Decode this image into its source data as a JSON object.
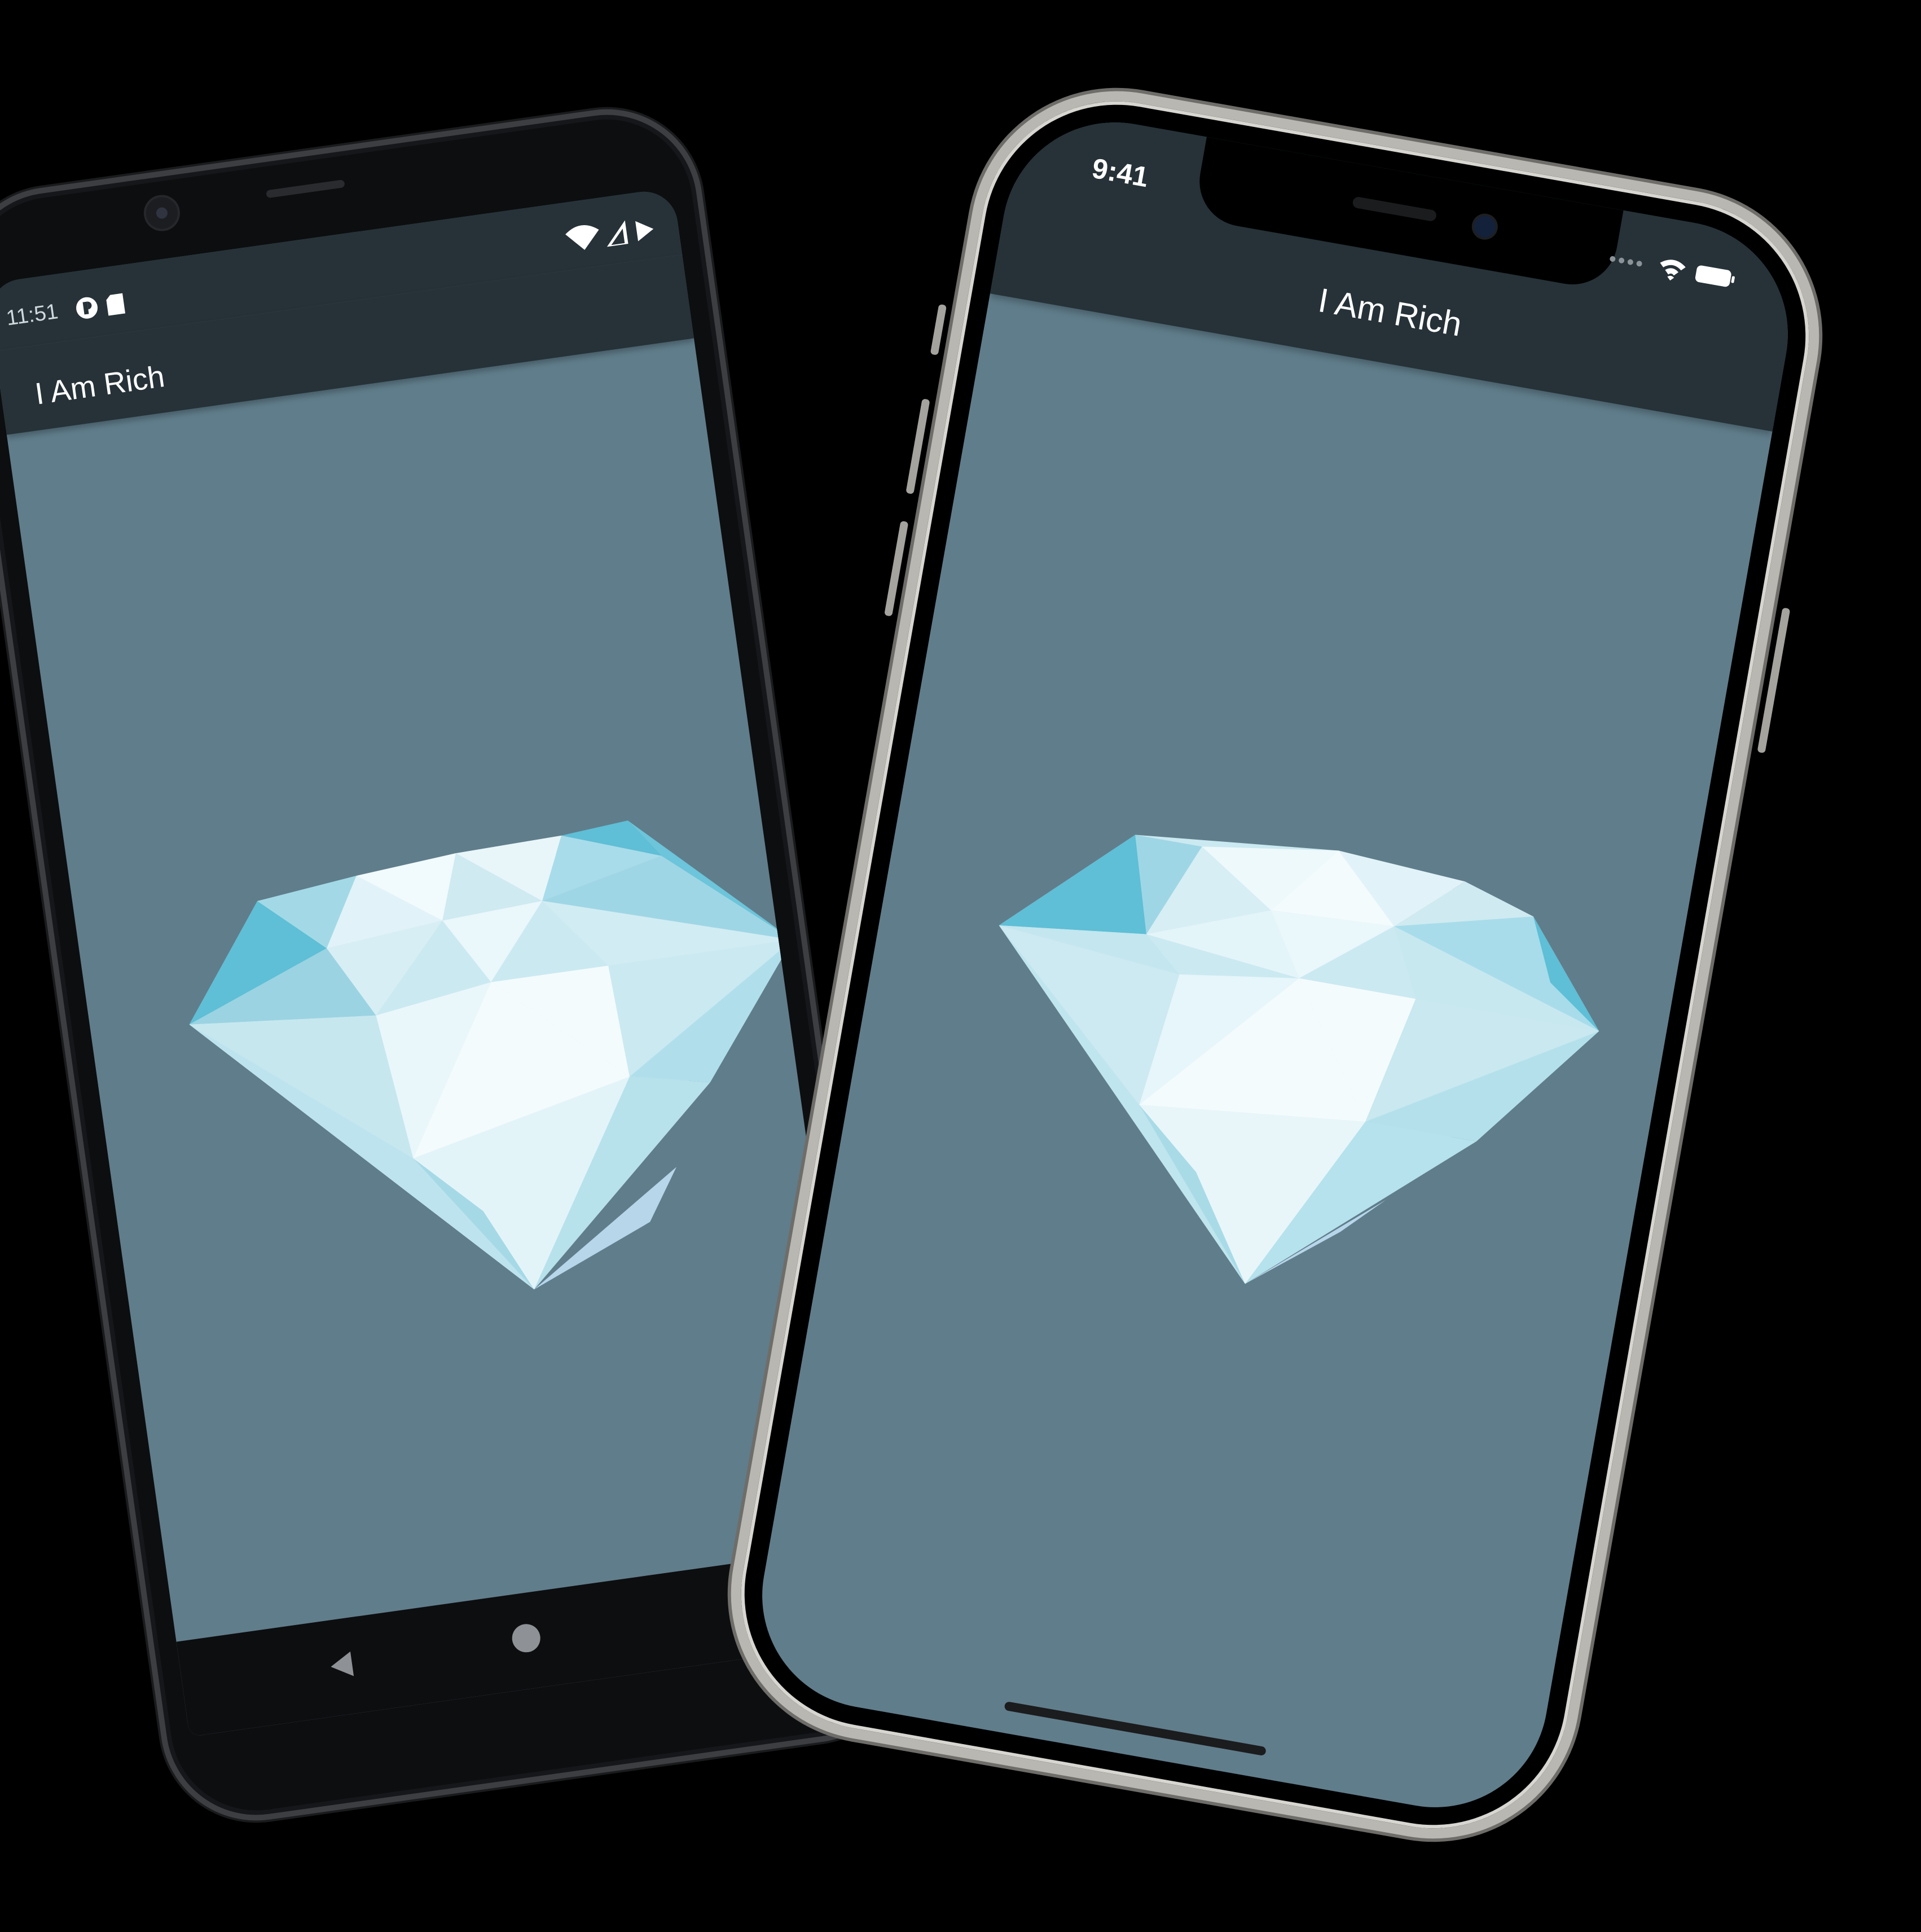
{
  "android": {
    "status_time": "11:51",
    "app_title": "I Am Rich",
    "status_icons": [
      "notification-icon",
      "sd-card-icon",
      "wifi-icon",
      "signal-icon",
      "battery-icon"
    ],
    "nav_buttons": [
      "back-icon",
      "home-icon"
    ]
  },
  "iphone": {
    "status_time": "9:41",
    "app_title": "I Am Rich",
    "status_icons": [
      "signal-dots-icon",
      "wifi-icon",
      "battery-icon"
    ]
  },
  "colors": {
    "app_bar": "#263238",
    "body_background": "#607d8b",
    "diamond_light": "#e8f6fb",
    "diamond_mid": "#bfe5ee",
    "diamond_dark": "#5ebfd6"
  },
  "image": {
    "subject": "diamond-icon"
  }
}
